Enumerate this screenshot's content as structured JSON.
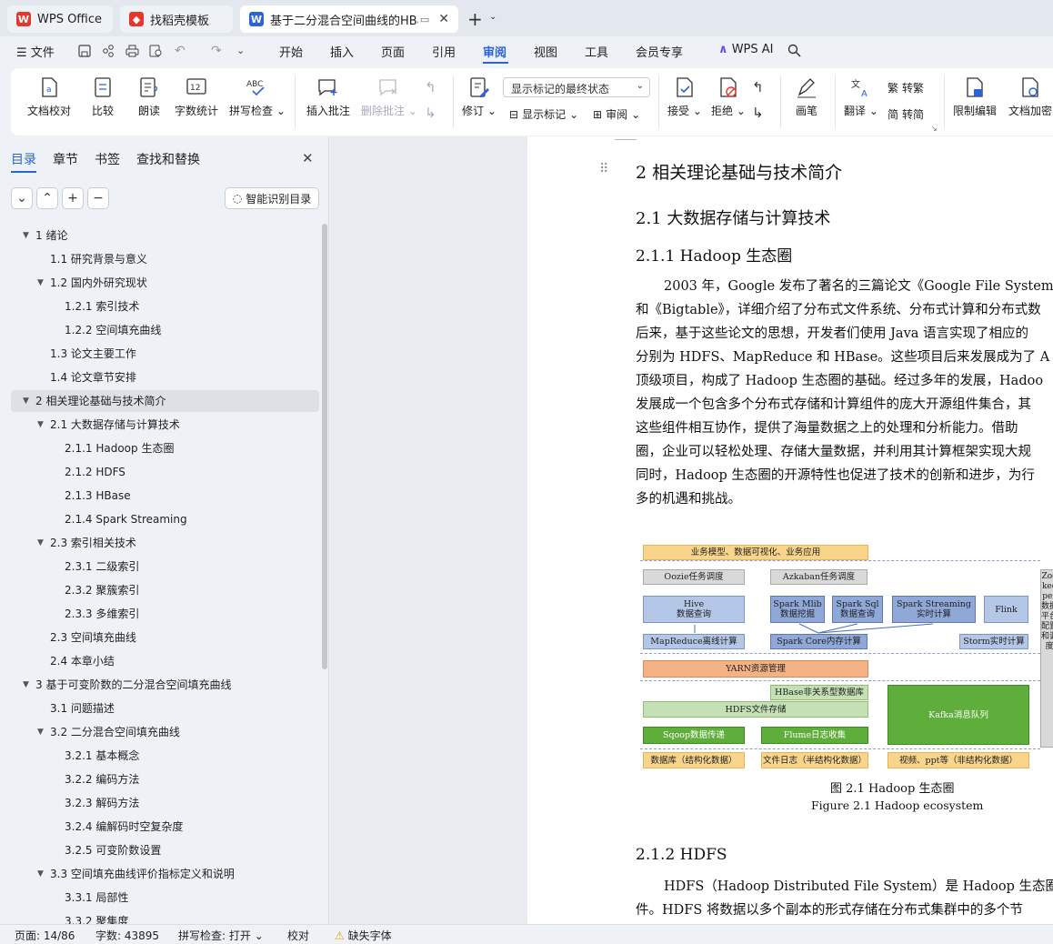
{
  "tabs": [
    {
      "label": "WPS Office"
    },
    {
      "label": "找稻壳模板"
    },
    {
      "label": "基于二分混合空间曲线的HBa"
    }
  ],
  "menu": {
    "file": "文件",
    "items": [
      "开始",
      "插入",
      "页面",
      "引用",
      "审阅",
      "视图",
      "工具",
      "会员专享"
    ],
    "active": "审阅",
    "wps_ai": "WPS AI"
  },
  "ribbon": {
    "doc_check": "文档校对",
    "compare": "比较",
    "read_aloud": "朗读",
    "word_count": "字数统计",
    "spell_check": "拼写检查",
    "spell_icon_text": "ABC",
    "insert_comment": "插入批注",
    "delete_comment": "删除批注",
    "track_changes": "修订",
    "display_state": "显示标记的最终状态",
    "show_markup": "显示标记",
    "review": "审阅",
    "accept": "接受",
    "reject": "拒绝",
    "ink": "画笔",
    "translate": "翻译",
    "to_traditional": "转繁",
    "to_simplified": "转简",
    "restrict_edit": "限制编辑",
    "doc_encrypt": "文档加密"
  },
  "panel": {
    "tabs": [
      "目录",
      "章节",
      "书签",
      "查找和替换"
    ],
    "smart_toc": "智能识别目录",
    "toc": [
      {
        "label": "1  绪论",
        "level": 0,
        "tri": true
      },
      {
        "label": "1.1  研究背景与意义",
        "level": 1
      },
      {
        "label": "1.2  国内外研究现状",
        "level": 1,
        "tri": true
      },
      {
        "label": "1.2.1  索引技术",
        "level": 2
      },
      {
        "label": "1.2.2  空间填充曲线",
        "level": 2
      },
      {
        "label": "1.3  论文主要工作",
        "level": 1
      },
      {
        "label": "1.4  论文章节安排",
        "level": 1
      },
      {
        "label": "2  相关理论基础与技术简介",
        "level": 0,
        "tri": true,
        "selected": true
      },
      {
        "label": "2.1  大数据存储与计算技术",
        "level": 1,
        "tri": true
      },
      {
        "label": "2.1.1 Hadoop 生态圈",
        "level": 2
      },
      {
        "label": "2.1.2 HDFS",
        "level": 2
      },
      {
        "label": "2.1.3 HBase",
        "level": 2
      },
      {
        "label": "2.1.4 Spark Streaming",
        "level": 2
      },
      {
        "label": "2.3  索引相关技术",
        "level": 1,
        "tri": true
      },
      {
        "label": "2.3.1  二级索引",
        "level": 2
      },
      {
        "label": "2.3.2  聚簇索引",
        "level": 2
      },
      {
        "label": "2.3.3  多维索引",
        "level": 2
      },
      {
        "label": "2.3  空间填充曲线",
        "level": 1
      },
      {
        "label": "2.4  本章小结",
        "level": 1
      },
      {
        "label": "3  基于可变阶数的二分混合空间填充曲线",
        "level": 0,
        "tri": true
      },
      {
        "label": "3.1  问题描述",
        "level": 1
      },
      {
        "label": "3.2  二分混合空间填充曲线",
        "level": 1,
        "tri": true
      },
      {
        "label": "3.2.1  基本概念",
        "level": 2
      },
      {
        "label": "3.2.2  编码方法",
        "level": 2
      },
      {
        "label": "3.2.3  解码方法",
        "level": 2
      },
      {
        "label": "3.2.4  编解码时空复杂度",
        "level": 2
      },
      {
        "label": "3.2.5  可变阶数设置",
        "level": 2
      },
      {
        "label": "3.3  空间填充曲线评价指标定义和说明",
        "level": 1,
        "tri": true
      },
      {
        "label": "3.3.1  局部性",
        "level": 2
      },
      {
        "label": "3.3.2  聚集度",
        "level": 2
      }
    ]
  },
  "doc": {
    "h_chapter": "2  相关理论基础与技术简介",
    "h_section": "2.1  大数据存储与计算技术",
    "h_sub1": "2.1.1 Hadoop 生态圈",
    "para1": [
      "2003 年，Google 发布了著名的三篇论文《Google File System》、",
      "和《Bigtable》，详细介绍了分布式文件系统、分布式计算和分布式数",
      "后来，基于这些论文的思想，开发者们使用 Java 语言实现了相应的",
      "分别为 HDFS、MapReduce 和 HBase。这些项目后来发展成为了 A",
      "顶级项目，构成了 Hadoop 生态圈的基础。经过多年的发展，Hadoo",
      "发展成一个包含多个分布式存储和计算组件的庞大开源组件集合，其",
      "这些组件相互协作，提供了海量数据之上的处理和分析能力。借助",
      "圈，企业可以轻松处理、存储大量数据，并利用其计算框架实现大规",
      "同时，Hadoop 生态圈的开源特性也促进了技术的创新和进步，为行",
      "多的机遇和挑战。"
    ],
    "figure": {
      "top": "业务模型、数据可视化、业务应用",
      "oozie": "Oozie任务调度",
      "azkaban": "Azkaban任务调度",
      "hive": "Hive\n数据查询",
      "mllib": "Spark Mlib\n数据挖掘",
      "sparksql": "Spark Sql\n数据查询",
      "streaming": "Spark Streaming\n实时计算",
      "flink": "Flink",
      "mapreduce": "MapReduce离线计算",
      "sparkcore": "Spark Core内存计算",
      "storm": "Storm实时计算",
      "yarn": "YARN资源管理",
      "hbase": "HBase非关系型数据库",
      "hdfs": "HDFS文件存储",
      "kafka": "Kafka消息队列",
      "sqoop": "Sqoop数据传递",
      "flume": "Flume日志收集",
      "src1": "数据库（结构化数据）",
      "src2": "文件日志（半结构化数据）",
      "src3": "视频、ppt等（非结构化数据）",
      "zookeeper": "Zookeeper",
      "zk_desc": "数据平台配置和调度"
    },
    "caption_cn": "图  2.1 Hadoop 生态圈",
    "caption_en": "Figure 2.1 Hadoop ecosystem",
    "h_sub2": "2.1.2 HDFS",
    "para2": [
      "HDFS（Hadoop Distributed File System）是 Hadoop 生态圈中的",
      "件。HDFS 将数据以多个副本的形式存储在分布式集群中的多个节"
    ]
  },
  "status": {
    "page": "页面: 14/86",
    "words": "字数: 43895",
    "spell": "拼写检查: 打开",
    "proof": "校对",
    "missing_font": "缺失字体"
  },
  "colors": {
    "accent": "#2b63d9",
    "wps_red": "#e8352e"
  }
}
